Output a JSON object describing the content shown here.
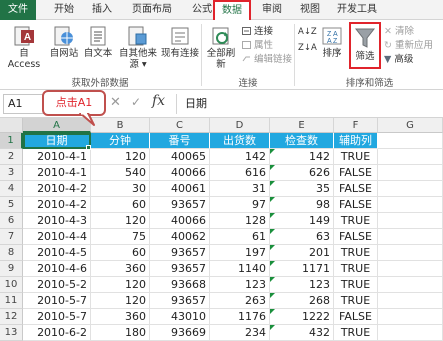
{
  "tabs": [
    "文件",
    "开始",
    "插入",
    "页面布局",
    "公式",
    "数据",
    "审阅",
    "视图",
    "开发工具"
  ],
  "active_tab": "数据",
  "ribbon": {
    "external": {
      "access": "自 Access",
      "web": "自网站",
      "text": "自文本",
      "other": "自其他来源",
      "existing": "现有连接",
      "label": "获取外部数据"
    },
    "connections": {
      "refresh_all": "全部刷新",
      "connections": "连接",
      "properties": "属性",
      "edit_links": "编辑链接",
      "label": "连接"
    },
    "sort_filter": {
      "sort_az": "A↓Z",
      "sort_za": "Z↓A",
      "sort": "排序",
      "filter": "筛选",
      "clear": "清除",
      "reapply": "重新应用",
      "advanced": "高级",
      "label": "排序和筛选"
    }
  },
  "formula_bar": {
    "name_box": "A1",
    "cancel": "✕",
    "enter": "✓",
    "fx": "fx",
    "value": "日期"
  },
  "callout": "点击A1",
  "columns": [
    "A",
    "B",
    "C",
    "D",
    "E",
    "F",
    "G"
  ],
  "table": {
    "headers": [
      "日期",
      "分钟",
      "番号",
      "出货数",
      "检查数",
      "辅助列"
    ],
    "rows": [
      [
        "2010-4-1",
        "120",
        "40065",
        "142",
        "142",
        "TRUE"
      ],
      [
        "2010-4-1",
        "540",
        "40066",
        "616",
        "626",
        "FALSE"
      ],
      [
        "2010-4-2",
        "30",
        "40061",
        "31",
        "35",
        "FALSE"
      ],
      [
        "2010-4-2",
        "60",
        "93657",
        "97",
        "98",
        "FALSE"
      ],
      [
        "2010-4-3",
        "120",
        "40066",
        "128",
        "149",
        "TRUE"
      ],
      [
        "2010-4-4",
        "75",
        "40062",
        "61",
        "63",
        "FALSE"
      ],
      [
        "2010-4-5",
        "60",
        "93657",
        "197",
        "201",
        "TRUE"
      ],
      [
        "2010-4-6",
        "360",
        "93657",
        "1140",
        "1171",
        "TRUE"
      ],
      [
        "2010-5-2",
        "120",
        "93668",
        "123",
        "123",
        "TRUE"
      ],
      [
        "2010-5-7",
        "120",
        "93657",
        "263",
        "268",
        "TRUE"
      ],
      [
        "2010-5-7",
        "360",
        "43010",
        "1176",
        "1222",
        "FALSE"
      ],
      [
        "2010-6-2",
        "180",
        "93669",
        "234",
        "432",
        "TRUE"
      ]
    ]
  },
  "colors": {
    "accent": "#217346",
    "header_fill": "#22a8e0",
    "highlight": "#e0242c"
  },
  "icons": [
    "access-icon",
    "web-icon",
    "text-file-icon",
    "other-sources-icon",
    "existing-connections-icon",
    "refresh-icon",
    "connections-icon",
    "properties-icon",
    "edit-links-icon",
    "sort-az-icon",
    "sort-za-icon",
    "sort-icon",
    "filter-icon",
    "clear-icon",
    "reapply-icon",
    "advanced-icon"
  ]
}
